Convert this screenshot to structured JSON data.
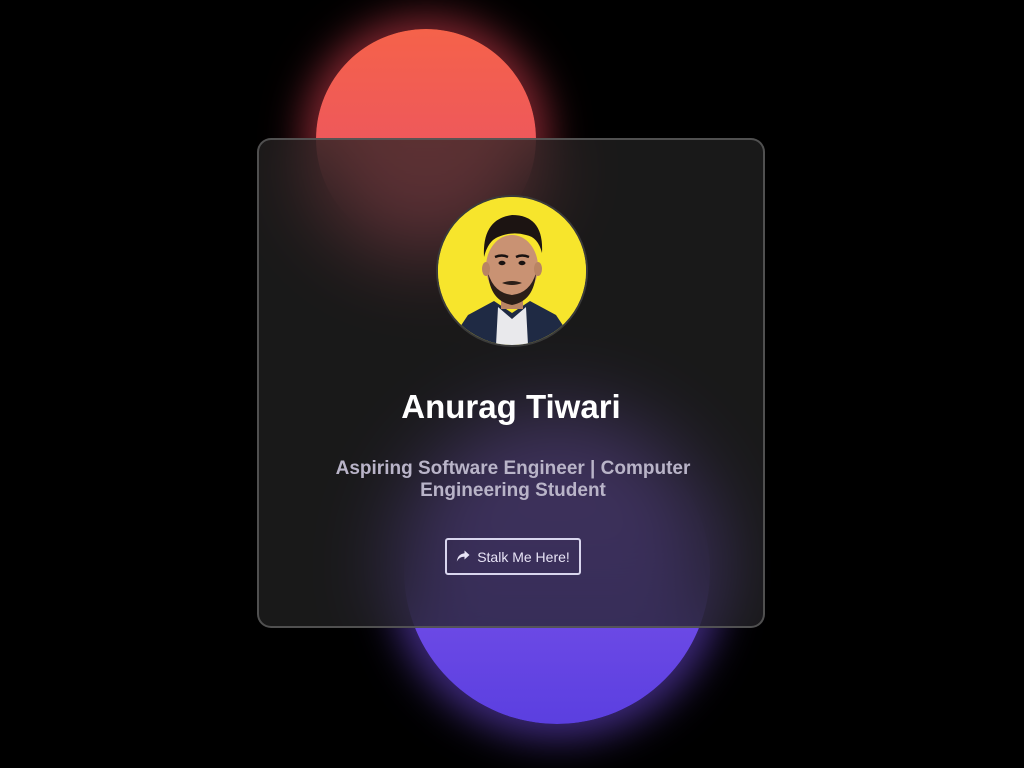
{
  "profile": {
    "name": "Anurag Tiwari",
    "tagline": "Aspiring Software Engineer | Computer Engineering Student",
    "avatar_alt": "Profile photo"
  },
  "cta": {
    "label": "Stalk Me Here!",
    "icon": "share-arrow-icon"
  },
  "colors": {
    "background": "#000000",
    "blob_red": "#f0566a",
    "blob_purple": "#7b55ea",
    "avatar_bg": "#f7e52c",
    "name_text": "#ffffff",
    "tagline_text": "#b9b4c8",
    "button_border": "#d9d6ee"
  }
}
